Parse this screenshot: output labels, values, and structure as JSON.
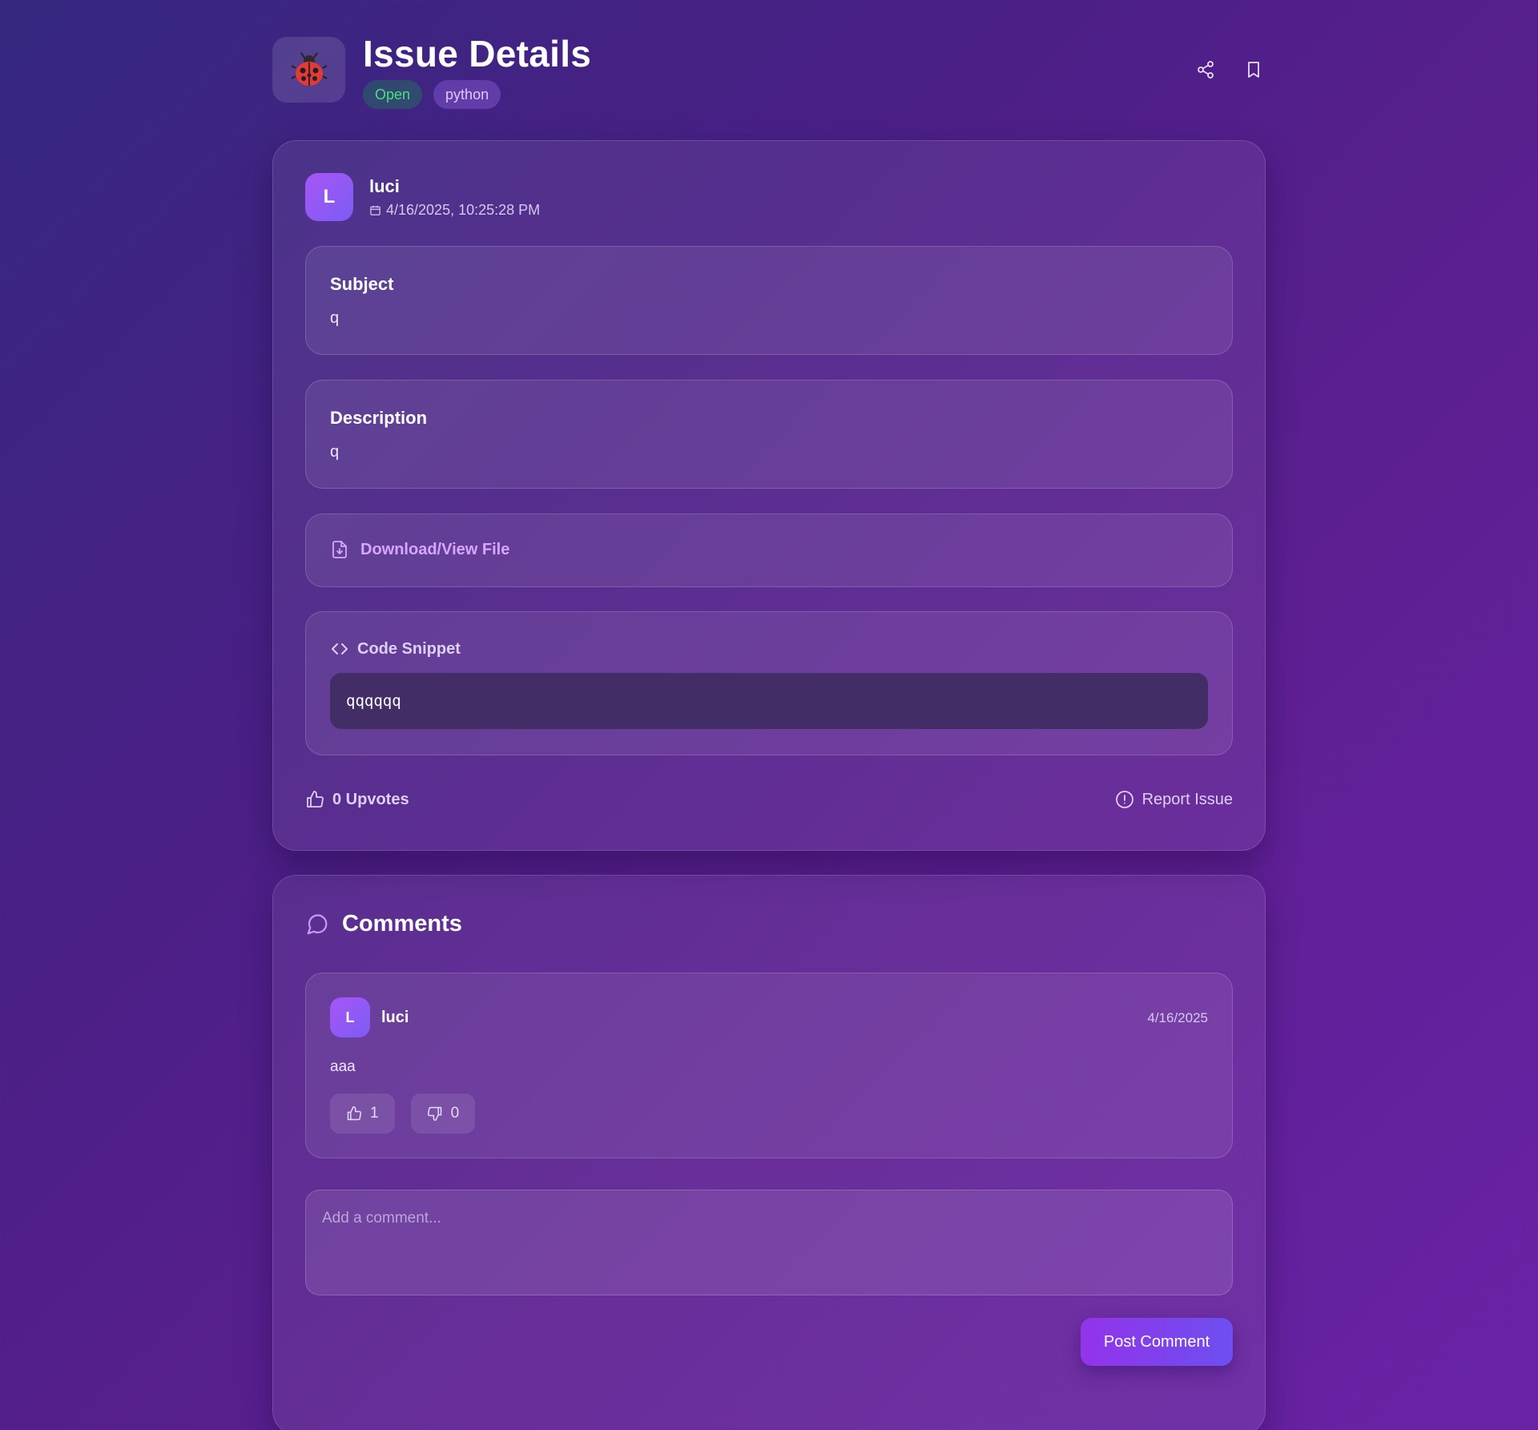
{
  "header": {
    "title": "Issue Details",
    "status": "Open",
    "tag": "python",
    "icons": [
      "bug-icon",
      "share-icon",
      "bookmark-icon"
    ]
  },
  "issue": {
    "author": {
      "initial": "L",
      "name": "luci",
      "timestamp": "4/16/2025, 10:25:28 PM"
    },
    "subject_label": "Subject",
    "subject": "q",
    "description_label": "Description",
    "description": "q",
    "file_link": "Download/View File",
    "code_label": "Code Snippet",
    "code": "qqqqqq",
    "upvotes": "0 Upvotes",
    "report": "Report Issue"
  },
  "comments": {
    "heading": "Comments",
    "items": [
      {
        "initial": "L",
        "name": "luci",
        "date": "4/16/2025",
        "text": "aaa",
        "likes": "1",
        "dislikes": "0"
      }
    ],
    "input_placeholder": "Add a comment...",
    "post_label": "Post Comment"
  },
  "colors": {
    "status_open": "#4ade80",
    "accent": "#9333ea",
    "link": "#d7a6ff"
  }
}
